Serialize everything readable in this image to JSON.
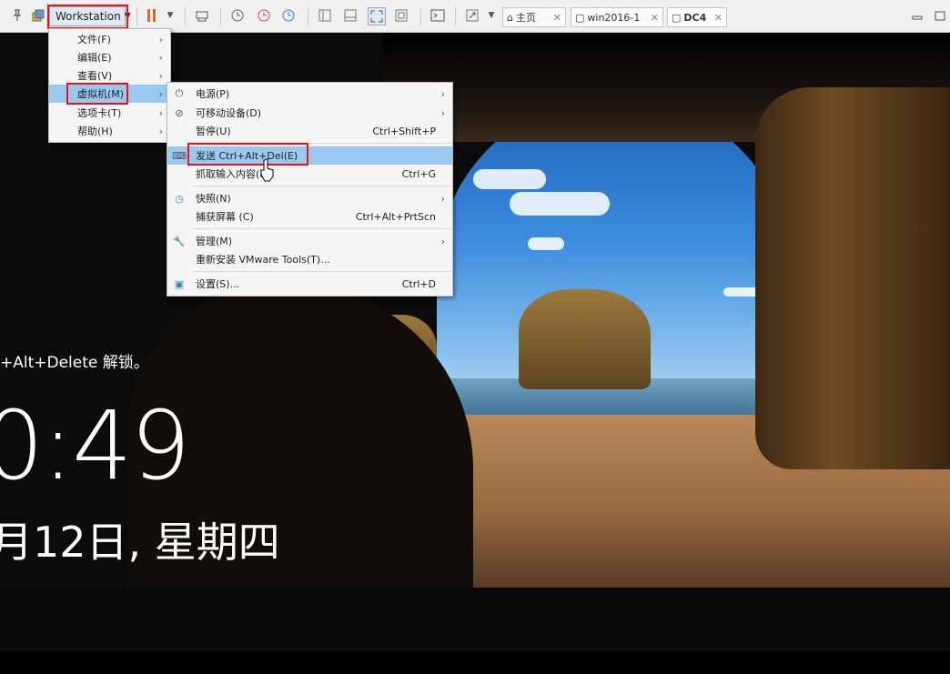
{
  "toolbar": {
    "workstation_label": "Workstation",
    "tabs": [
      {
        "label": "主页",
        "icon": "home-icon"
      },
      {
        "label": "win2016-1",
        "icon": "vm-icon"
      },
      {
        "label": "DC4",
        "icon": "vm-icon"
      }
    ],
    "close_glyph": "✕"
  },
  "workstation_menu": {
    "items": [
      {
        "label": "文件(F)"
      },
      {
        "label": "编辑(E)"
      },
      {
        "label": "查看(V)"
      },
      {
        "label": "虚拟机(M)"
      },
      {
        "label": "选项卡(T)"
      },
      {
        "label": "帮助(H)"
      }
    ]
  },
  "vm_menu": {
    "items": [
      {
        "label": "电源(P)",
        "shortcut": "",
        "icon": "power-icon"
      },
      {
        "label": "可移动设备(D)",
        "shortcut": "",
        "icon": "removable-device-icon"
      },
      {
        "label": "暂停(U)",
        "shortcut": "Ctrl+Shift+P",
        "icon": ""
      },
      {
        "label": "发送 Ctrl+Alt+Del(E)",
        "shortcut": "",
        "icon": "keyboard-icon"
      },
      {
        "label": "抓取输入内容(I)",
        "shortcut": "Ctrl+G",
        "icon": ""
      },
      {
        "label": "快照(N)",
        "shortcut": "",
        "icon": "snapshot-icon"
      },
      {
        "label": "捕获屏幕 (C)",
        "shortcut": "Ctrl+Alt+PrtScn",
        "icon": ""
      },
      {
        "label": "管理(M)",
        "shortcut": "",
        "icon": "wrench-icon"
      },
      {
        "label": "重新安装 VMware Tools(T)...",
        "shortcut": "",
        "icon": ""
      },
      {
        "label": "设置(S)...",
        "shortcut": "Ctrl+D",
        "icon": "settings-icon"
      }
    ]
  },
  "lockscreen": {
    "hint": "+Alt+Delete 解锁。",
    "time": "0:49",
    "date": "月12日, 星期四"
  },
  "colors": {
    "highlight": "#99c9ef",
    "annotation_red": "#e11111",
    "pause_orange": "#e8641e"
  }
}
